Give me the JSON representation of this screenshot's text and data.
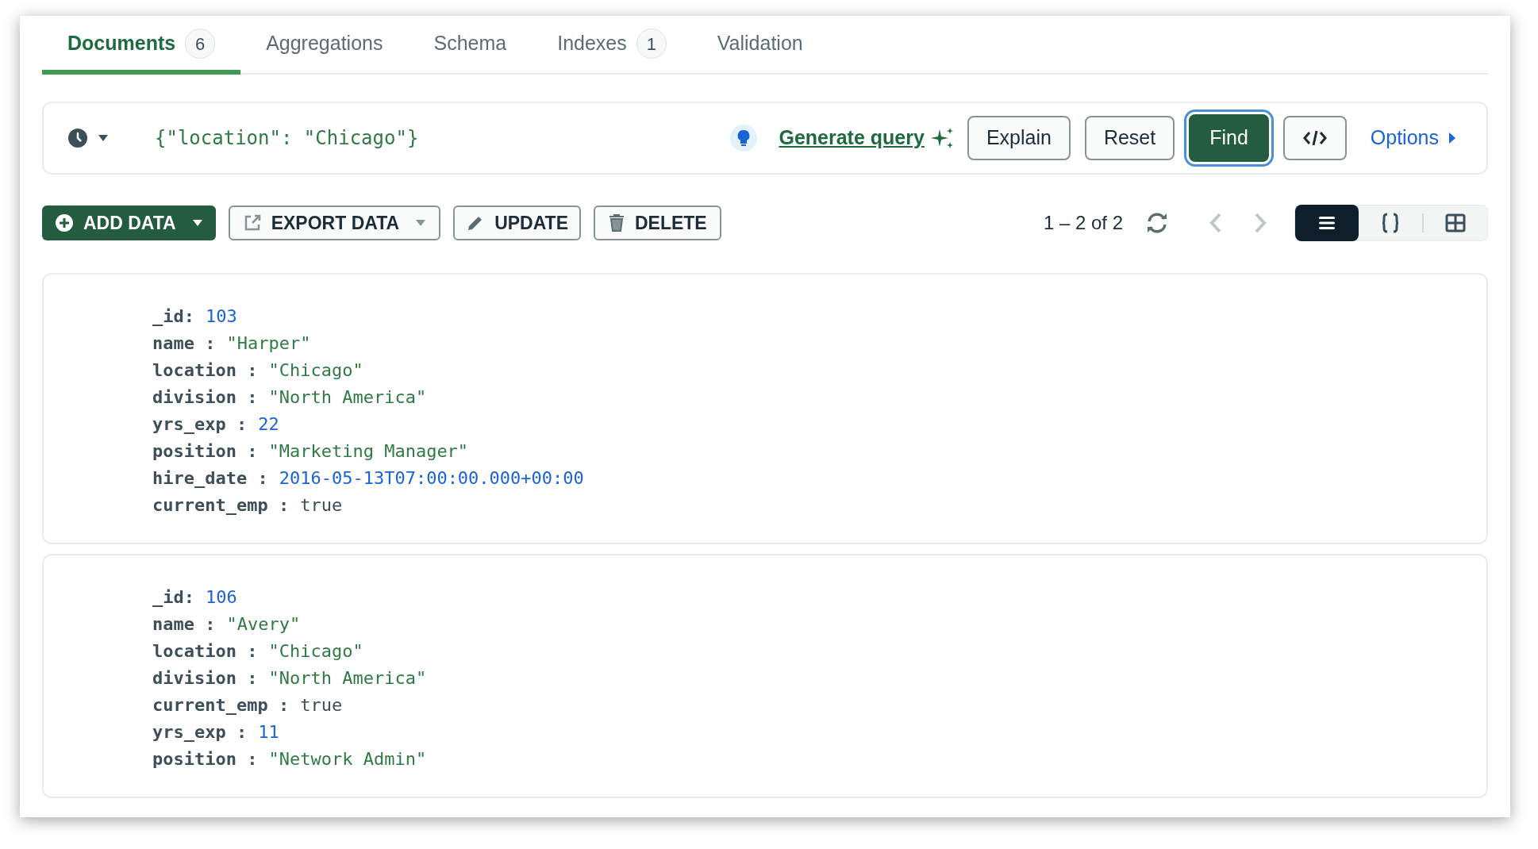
{
  "tabs": [
    {
      "label": "Documents",
      "count": "6",
      "selected": true
    },
    {
      "label": "Aggregations",
      "selected": false
    },
    {
      "label": "Schema",
      "selected": false
    },
    {
      "label": "Indexes",
      "count": "1",
      "selected": false
    },
    {
      "label": "Validation",
      "selected": false
    }
  ],
  "query_bar": {
    "filter": "{\"location\": \"Chicago\"}",
    "generate_link": "Generate query",
    "buttons": [
      {
        "label": "Explain",
        "kind": "outline"
      },
      {
        "label": "Reset",
        "kind": "outline"
      },
      {
        "label": "Find",
        "kind": "primary"
      }
    ],
    "options": "Options"
  },
  "toolbar": {
    "add": "ADD DATA",
    "export": "EXPORT DATA",
    "update": "UPDATE",
    "delete": "DELETE",
    "pagination": "1 – 2 of 2",
    "views": [
      {
        "kind": "list",
        "selected": true
      },
      {
        "kind": "json",
        "selected": false
      },
      {
        "kind": "table",
        "selected": false
      }
    ]
  },
  "documents": [
    {
      "fields": [
        {
          "key": "_id:",
          "value": "103",
          "kind": "number"
        },
        {
          "key": "name :",
          "value": "\"Harper\"",
          "kind": "string"
        },
        {
          "key": "location :",
          "value": "\"Chicago\"",
          "kind": "string"
        },
        {
          "key": "division :",
          "value": "\"North America\"",
          "kind": "string"
        },
        {
          "key": "yrs_exp :",
          "value": "22",
          "kind": "number"
        },
        {
          "key": "position :",
          "value": "\"Marketing Manager\"",
          "kind": "string"
        },
        {
          "key": "hire_date :",
          "value": "2016-05-13T07:00:00.000+00:00",
          "kind": "date"
        },
        {
          "key": "current_emp :",
          "value": "true",
          "kind": "boolean"
        }
      ]
    },
    {
      "fields": [
        {
          "key": "_id:",
          "value": "106",
          "kind": "number"
        },
        {
          "key": "name :",
          "value": "\"Avery\"",
          "kind": "string"
        },
        {
          "key": "location :",
          "value": "\"Chicago\"",
          "kind": "string"
        },
        {
          "key": "division :",
          "value": "\"North America\"",
          "kind": "string"
        },
        {
          "key": "current_emp :",
          "value": "true",
          "kind": "boolean"
        },
        {
          "key": "yrs_exp :",
          "value": "11",
          "kind": "number"
        },
        {
          "key": "position :",
          "value": "\"Network Admin\"",
          "kind": "string"
        }
      ]
    }
  ]
}
